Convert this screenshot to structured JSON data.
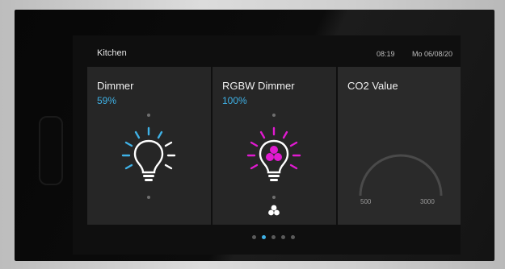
{
  "header": {
    "room": "Kitchen",
    "time": "08:19",
    "date": "Mo 06/08/20"
  },
  "tiles": [
    {
      "title": "Dimmer",
      "value": "59%",
      "icon": "lightbulb-icon",
      "accent": "#3fb1e6"
    },
    {
      "title": "RGBW Dimmer",
      "value": "100%",
      "icon": "rgb-lightbulb-icon",
      "accent": "#e01ad0"
    },
    {
      "title": "CO2 Value",
      "gauge_min": "500",
      "gauge_max": "3000"
    }
  ],
  "pager": {
    "pages": 5,
    "active_index": 1
  }
}
